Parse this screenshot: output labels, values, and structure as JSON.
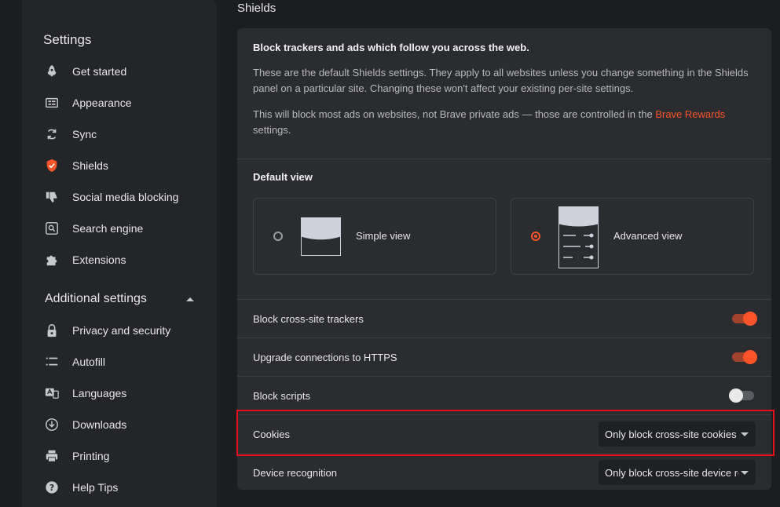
{
  "sidebar": {
    "title": "Settings",
    "items": [
      {
        "label": "Get started",
        "icon": "rocket-icon"
      },
      {
        "label": "Appearance",
        "icon": "appearance-icon"
      },
      {
        "label": "Sync",
        "icon": "sync-icon"
      },
      {
        "label": "Shields",
        "icon": "shield-icon"
      },
      {
        "label": "Social media blocking",
        "icon": "thumbs-down-icon"
      },
      {
        "label": "Search engine",
        "icon": "search-icon"
      },
      {
        "label": "Extensions",
        "icon": "puzzle-icon"
      }
    ],
    "additional_title": "Additional settings",
    "additional_items": [
      {
        "label": "Privacy and security",
        "icon": "lock-icon"
      },
      {
        "label": "Autofill",
        "icon": "list-icon"
      },
      {
        "label": "Languages",
        "icon": "language-icon"
      },
      {
        "label": "Downloads",
        "icon": "download-icon"
      },
      {
        "label": "Printing",
        "icon": "printer-icon"
      },
      {
        "label": "Help Tips",
        "icon": "help-icon"
      }
    ]
  },
  "main": {
    "title": "Shields",
    "intro": {
      "heading": "Block trackers and ads which follow you across the web.",
      "p1": "These are the default Shields settings. They apply to all websites unless you change something in the Shields panel on a particular site. Changing these won't affect your existing per-site settings.",
      "p2_before": "This will block most ads on websites, not Brave private ads — those are controlled in the ",
      "p2_link": "Brave Rewards",
      "p2_after": " settings."
    },
    "default_view": {
      "heading": "Default view",
      "simple_label": "Simple view",
      "advanced_label": "Advanced view",
      "selected": "advanced"
    },
    "settings": [
      {
        "label": "Block cross-site trackers",
        "type": "toggle",
        "on": true
      },
      {
        "label": "Upgrade connections to HTTPS",
        "type": "toggle",
        "on": true
      },
      {
        "label": "Block scripts",
        "type": "toggle",
        "on": false
      },
      {
        "label": "Cookies",
        "type": "select",
        "value": "Only block cross-site cookies"
      },
      {
        "label": "Device recognition",
        "type": "select",
        "value": "Only block cross-site device recognition attempts"
      }
    ]
  },
  "colors": {
    "accent": "#fb542b",
    "highlight": "#e4111b"
  }
}
